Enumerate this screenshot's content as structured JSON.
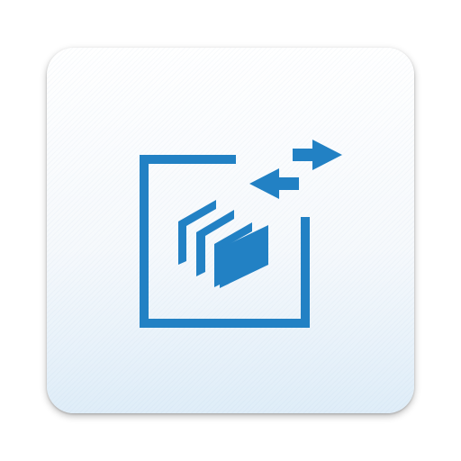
{
  "app_icon": {
    "icon_name": "transfer-files-icon",
    "accent_color": "#2281C4"
  }
}
